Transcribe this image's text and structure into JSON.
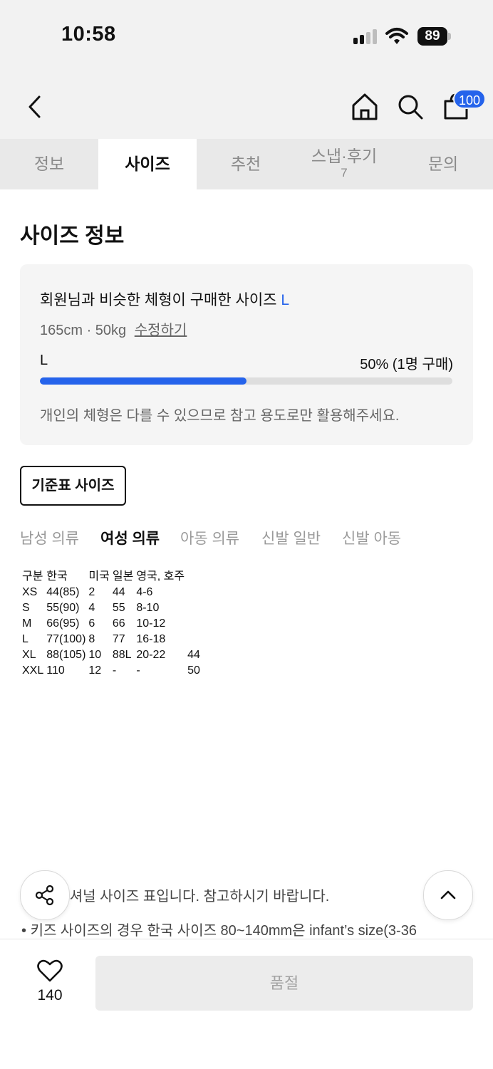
{
  "status_bar": {
    "time": "10:58",
    "battery": "89"
  },
  "header": {
    "cart_badge": "100"
  },
  "tabs": [
    {
      "label": "정보",
      "count": ""
    },
    {
      "label": "사이즈",
      "count": ""
    },
    {
      "label": "추천",
      "count": ""
    },
    {
      "label": "스냅·후기",
      "count": "7"
    },
    {
      "label": "문의",
      "count": ""
    }
  ],
  "size_info": {
    "title": "사이즈 정보",
    "similar_label": "회원님과 비슷한 체형이 구매한 사이즈",
    "similar_size": "L",
    "body_stats": "165cm · 50kg",
    "edit_link": "수정하기",
    "bar_label": "L",
    "bar_value": "50% (1명 구매)",
    "bar_fraction": 0.5,
    "note": "개인의 체형은 다를 수 있으므로 참고 용도로만 활용해주세요."
  },
  "standard_button": "기준표 사이즈",
  "categories": [
    "남성 의류",
    "여성 의류",
    "아동 의류",
    "신발 일반",
    "신발 아동"
  ],
  "active_category": 1,
  "size_table": {
    "headers": [
      "구분",
      "한국",
      "미국",
      "일본",
      "영국, 호주",
      ""
    ],
    "rows": [
      [
        "XS",
        "44(85)",
        "2",
        "44",
        "4-6",
        ""
      ],
      [
        "S",
        "55(90)",
        "4",
        "55",
        "8-10",
        ""
      ],
      [
        "M",
        "66(95)",
        "6",
        "66",
        "10-12",
        ""
      ],
      [
        "L",
        "77(100)",
        "8",
        "77",
        "16-18",
        ""
      ],
      [
        "XL",
        "88(105)",
        "10",
        "88L",
        "20-22",
        "44"
      ],
      [
        "XXL",
        "110",
        "12",
        "-",
        "-",
        "50"
      ]
    ]
  },
  "notes": [
    "인터내셔널 사이즈 표입니다. 참고하시기 바랍니다.",
    "키즈 사이즈의 경우 한국 사이즈 80~140mm은 infant’s size(3-36"
  ],
  "bottom": {
    "likes": "140",
    "soldout": "품절"
  },
  "colors": {
    "accent": "#2563eb"
  }
}
